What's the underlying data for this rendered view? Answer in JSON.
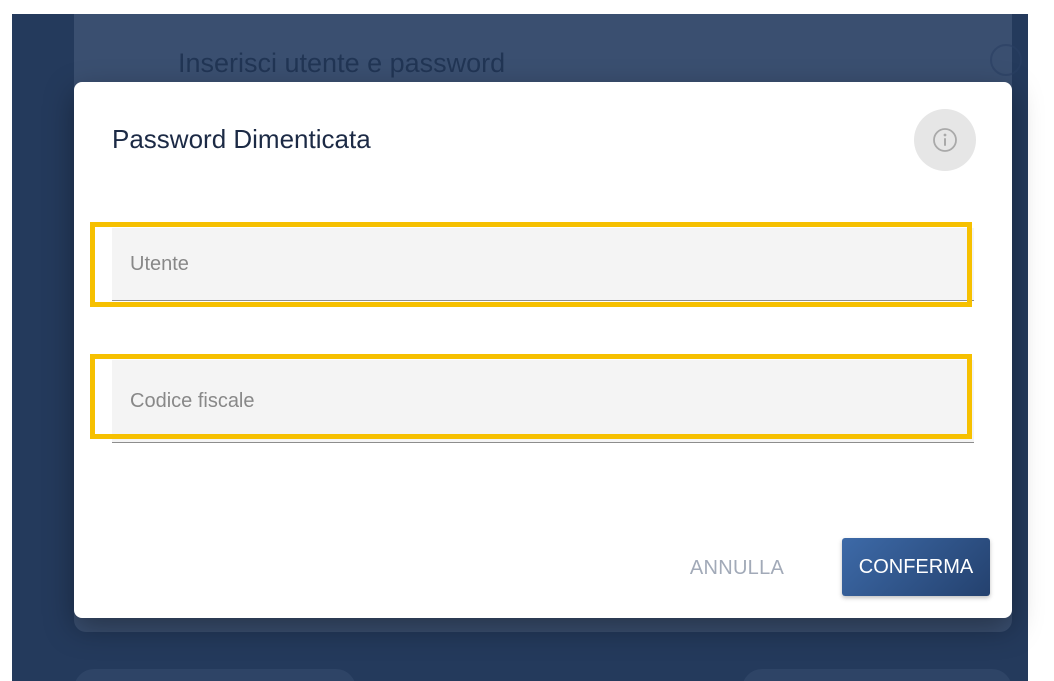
{
  "background": {
    "title": "Inserisci utente e password",
    "icon": "info-icon"
  },
  "dialog": {
    "title": "Password Dimenticata",
    "info_icon": "info-icon",
    "fields": {
      "user_placeholder": "Utente",
      "user_value": "",
      "cf_placeholder": "Codice fiscale",
      "cf_value": ""
    },
    "buttons": {
      "cancel": "ANNULLA",
      "confirm": "CONFERMA"
    }
  },
  "colors": {
    "highlight": "#f6c000",
    "confirm_button": "#2f5590",
    "backdrop": "#243a5c"
  }
}
